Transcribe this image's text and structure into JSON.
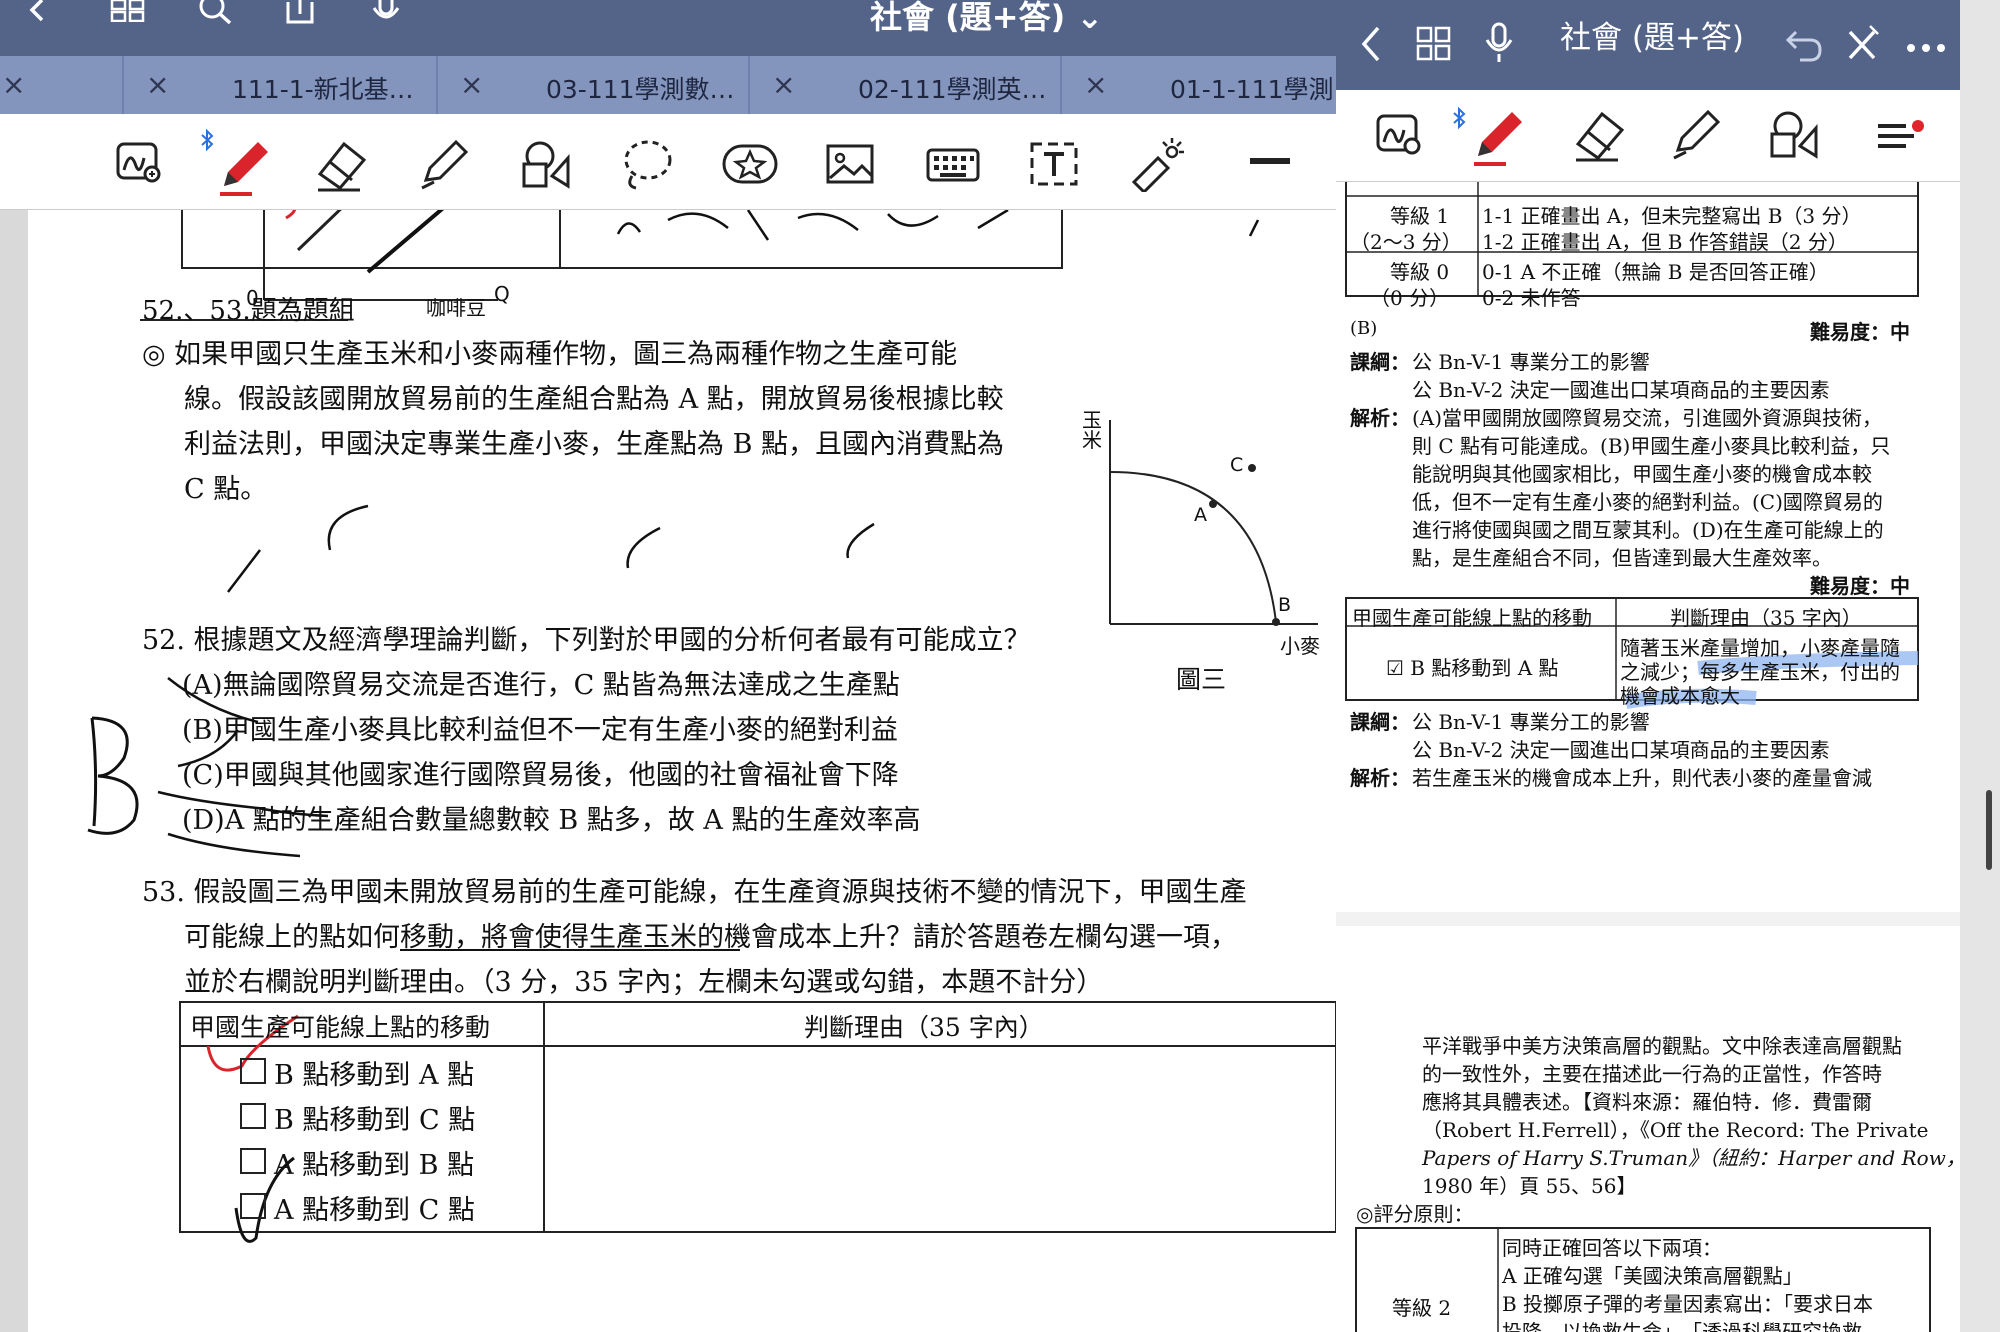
{
  "left": {
    "title": "社會 (題+答) ⌄",
    "tabs": [
      {
        "close": "×",
        "label": ""
      },
      {
        "close": "×",
        "label": "111-1-新北基…"
      },
      {
        "close": "×",
        "label": "03-111學測數…"
      },
      {
        "close": "×",
        "label": "02-111學測英…"
      },
      {
        "close": "×",
        "label": "01-1-111學測…"
      }
    ],
    "top_icons": [
      "back-chevron-icon",
      "grid-icon",
      "search-icon",
      "share-icon",
      "microphone-icon"
    ],
    "toolbar_icons": [
      "lasso-zoom-icon",
      "pen-icon",
      "eraser-icon",
      "highlighter-icon",
      "shapes-icon",
      "lasso-icon",
      "sticker-icon",
      "image-icon",
      "keyboard-icon",
      "text-box-icon",
      "laser-pointer-icon"
    ],
    "doc": {
      "graph_top": {
        "origin": "0",
        "x_label": "咖啡豆",
        "x_axis": "Q"
      },
      "group_heading": "52.、53.題為題組",
      "intro": [
        "◎ 如果甲國只生產玉米和小麥兩種作物，圖三為兩種作物之生產可能",
        "線。假設該國開放貿易前的生產組合點為 A 點，開放貿易後根據比較",
        "利益法則，甲國決定專業生產小麥，生產點為 B 點，且國內消費點為",
        "C 點。"
      ],
      "figure": {
        "y_label": "玉米",
        "x_label": "小麥",
        "caption": "圖三",
        "point_a": "A",
        "point_b": "B",
        "point_c": "C"
      },
      "q52": {
        "stem": "52. 根據題文及經濟學理論判斷，下列對於甲國的分析何者最有可能成立？",
        "options": [
          "(A)無論國際貿易交流是否進行，C 點皆為無法達成之生產點",
          "(B)甲國生產小麥具比較利益但不一定有生產小麥的絕對利益",
          "(C)甲國與其他國家進行國際貿易後，他國的社會福祉會下降",
          "(D)A 點的生產組合數量總數較 B 點多，故 A 點的生產效率高"
        ]
      },
      "q53": {
        "stem": [
          "53. 假設圖三為甲國未開放貿易前的生產可能線，在生產資源與技術不變的情況下，甲國生產",
          "可能線上的點如何移動，將會使得生產玉米的機會成本上升？請於答題卷左欄勾選一項，",
          "並於右欄說明判斷理由。（3 分，35 字內；左欄未勾選或勾錯，本題不計分）"
        ],
        "table_headers": [
          "甲國生產可能線上點的移動",
          "判斷理由（35 字內）"
        ],
        "choices": [
          "B 點移動到 A 點",
          "B 點移動到 C 點",
          "A 點移動到 B 點",
          "A 點移動到 C 點"
        ]
      }
    }
  },
  "right": {
    "title": "社會 (題+答)",
    "top_icons": [
      "back-chevron-icon",
      "grid-icon",
      "microphone-icon",
      "undo-icon",
      "close-icon",
      "more-icon"
    ],
    "toolbar_icons": [
      "lasso-zoom-icon",
      "pen-icon",
      "eraser-icon",
      "highlighter-icon",
      "shapes-icon",
      "menu-icon"
    ],
    "page1": {
      "rubric_top": [
        {
          "level": "等級 1",
          "score": "（2～3 分）",
          "desc": [
            "1-1 正確畫出 A，但未完整寫出 B（3 分）",
            "1-2 正確畫出 A，但 B 作答錯誤（2 分）"
          ]
        },
        {
          "level": "等級 0",
          "score": "（0 分）",
          "desc": [
            "0-1 A 不正確（無論 B 是否回答正確）",
            "0-2 未作答"
          ]
        }
      ],
      "answer52": "(B)",
      "difficulty_label": "難易度：中",
      "outline_label": "課綱：",
      "outline_lines": [
        "公 Bn-V-1 專業分工的影響",
        "公 Bn-V-2 決定一國進出口某項商品的主要因素"
      ],
      "analysis_label": "解析：",
      "analysis_lines": [
        "(A)當甲國開放國際貿易交流，引進國外資源與技術，",
        "則 C 點有可能達成。(B)甲國生產小麥具比較利益，只",
        "能說明與其他國家相比，甲國生產小麥的機會成本較",
        "低，但不一定有生產小麥的絕對利益。(C)國際貿易的",
        "進行將使國與國之間互蒙其利。(D)在生產可能線上的",
        "點，是生產組合不同，但皆達到最大生產效率。"
      ],
      "difficulty53": "難易度：中",
      "answer_table": {
        "headers": [
          "甲國生產可能線上點的移動",
          "判斷理由（35 字內）"
        ],
        "choice": "☑ B 點移動到 A 點",
        "reason_lines": [
          "隨著玉米產量增加，小麥產量隨",
          "之減少；每多生產玉米，付出的",
          "機會成本愈大"
        ]
      },
      "outline53_lines": [
        "公 Bn-V-1 專業分工的影響",
        "公 Bn-V-2 決定一國進出口某項商品的主要因素"
      ],
      "analysis53": "若生產玉米的機會成本上升，則代表小麥的產量會減"
    },
    "page2": {
      "lines": [
        "平洋戰爭中美方決策高層的觀點。文中除表達高層觀點",
        "的一致性外，主要在描述此一行為的正當性，作答時",
        "應將其具體表述。【資料來源：羅伯特．修．費雷爾",
        "（Robert H.Ferrell），《Off the Record: The Private",
        "Papers of Harry S.Truman》（紐約：Harper and Row，",
        "1980 年）頁 55、56】"
      ],
      "criteria_label": "◎評分原則：",
      "rubric": {
        "level": "等級 2",
        "desc": [
          "同時正確回答以下兩項：",
          "A 正確勾選「美國決策高層觀點」",
          "B 投擲原子彈的考量因素寫出：「要求日本",
          "投降，以換救生命」、「透過科學研究換救"
        ]
      }
    }
  },
  "colors": {
    "title_bar": "#546489",
    "tab_bar": "#8394bd",
    "pen_red": "#d9242b",
    "highlight_blue": "#8fb4ef"
  }
}
